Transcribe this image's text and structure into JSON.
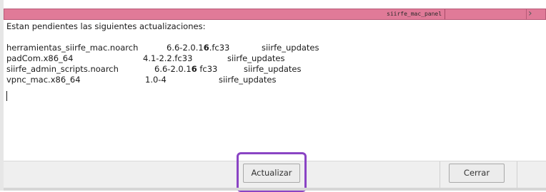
{
  "window": {
    "title": "siirfe_mac_panel",
    "titlebar_color": "#e07a98",
    "close_glyph": "›"
  },
  "content": {
    "header": "Estan pendientes las siguientes actualizaciones:",
    "updates": [
      {
        "package": "herramientas_siirfe_mac.noarch",
        "version_pre": "6.6-2.0.1",
        "version_bold": "6",
        "version_post": ".fc33",
        "repo": "siirfe_updates"
      },
      {
        "package": "padCom.x86_64",
        "version_pre": "4.1-2.2.fc33",
        "version_bold": "",
        "version_post": "",
        "repo": "siirfe_updates"
      },
      {
        "package": "siirfe_admin_scripts.noarch",
        "version_pre": "6.6-2.0.1",
        "version_bold": "6",
        "version_post": " fc33",
        "repo": "siirfe_updates"
      },
      {
        "package": "vpnc_mac.x86_64",
        "version_pre": "1.0-4",
        "version_bold": "",
        "version_post": "",
        "repo": "siirfe_updates"
      }
    ]
  },
  "buttons": {
    "update_label": "Actualizar",
    "close_label": "Cerrar"
  },
  "accent": {
    "highlight_color": "#8a44c4"
  }
}
